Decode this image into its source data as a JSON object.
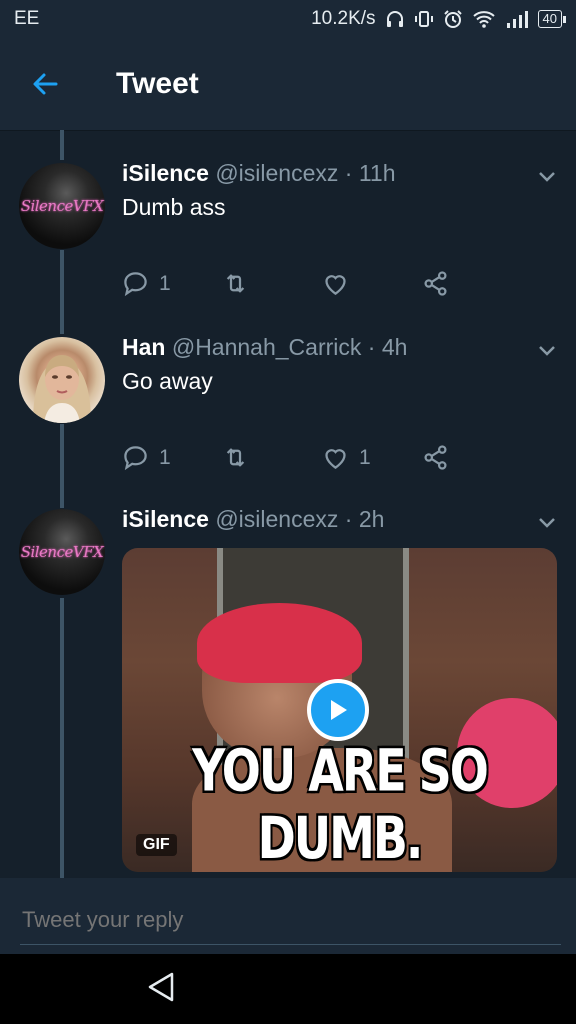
{
  "status_bar": {
    "carrier": "EE",
    "network_speed": "10.2K/s",
    "battery": "40"
  },
  "header": {
    "title": "Tweet"
  },
  "tweets": [
    {
      "name": "iSilence",
      "handle": "@isilencexz",
      "time": "· 11h",
      "text": "Dumb ass",
      "avatar_text": "SilenceVFX",
      "reply_count": "1",
      "retweet_count": "",
      "like_count": ""
    },
    {
      "name": "Han",
      "handle": "@Hannah_Carrick",
      "time": "· 4h",
      "text": "Go away",
      "reply_count": "1",
      "retweet_count": "",
      "like_count": "1"
    },
    {
      "name": "iSilence",
      "handle": "@isilencexz",
      "time": "· 2h",
      "avatar_text": "SilenceVFX",
      "media": {
        "caption": "YOU ARE SO DUMB.",
        "badge": "GIF"
      }
    }
  ],
  "reply": {
    "placeholder": "Tweet your reply"
  },
  "colors": {
    "background": "#15202b",
    "accent": "#1da1f2",
    "muted": "#8899a6"
  }
}
